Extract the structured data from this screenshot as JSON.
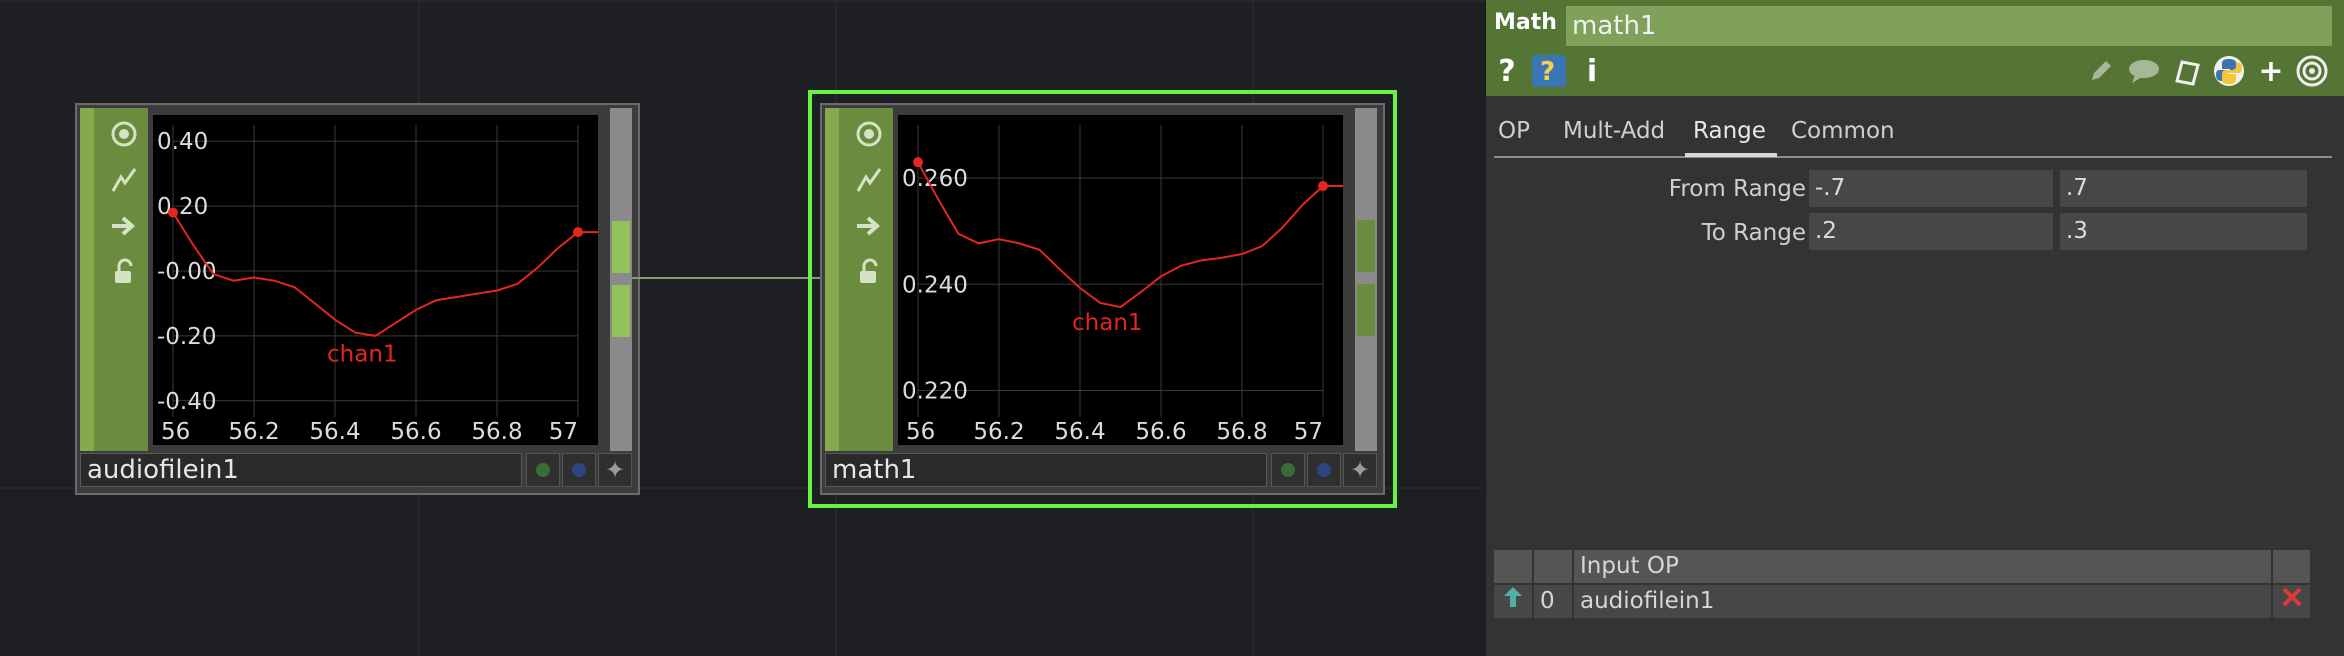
{
  "network": {
    "nodes": [
      {
        "name": "audiofilein1",
        "selected": false,
        "chart_data": {
          "type": "line",
          "series": [
            {
              "name": "chan1",
              "color": "#e3261f",
              "x": [
                56.0,
                56.05,
                56.1,
                56.15,
                56.2,
                56.25,
                56.3,
                56.35,
                56.4,
                56.45,
                56.5,
                56.55,
                56.6,
                56.65,
                56.7,
                56.75,
                56.8,
                56.85,
                56.9,
                56.95,
                57.0
              ],
              "y": [
                0.18,
                0.08,
                -0.01,
                -0.03,
                -0.02,
                -0.03,
                -0.05,
                -0.1,
                -0.15,
                -0.19,
                -0.2,
                -0.16,
                -0.12,
                -0.09,
                -0.08,
                -0.07,
                -0.06,
                -0.04,
                0.01,
                0.07,
                0.12
              ]
            }
          ],
          "xlim": [
            56,
            57
          ],
          "ylim": [
            -0.45,
            0.45
          ],
          "xticks": [
            "56",
            "56.2",
            "56.4",
            "56.6",
            "56.8",
            "57"
          ],
          "yticks": [
            "0.40",
            "0.20",
            "-0.00",
            "-0.20",
            "-0.40"
          ],
          "yvals": [
            0.4,
            0.2,
            0.0,
            -0.2,
            -0.4
          ]
        }
      },
      {
        "name": "math1",
        "selected": true,
        "chart_data": {
          "type": "line",
          "series": [
            {
              "name": "chan1",
              "color": "#e3261f",
              "x": [
                56.0,
                56.05,
                56.1,
                56.15,
                56.2,
                56.25,
                56.3,
                56.35,
                56.4,
                56.45,
                56.5,
                56.55,
                56.6,
                56.65,
                56.7,
                56.75,
                56.8,
                56.85,
                56.9,
                56.95,
                57.0
              ],
              "y": [
                0.263,
                0.256,
                0.2495,
                0.2477,
                0.2485,
                0.2477,
                0.2465,
                0.2428,
                0.2393,
                0.2365,
                0.2357,
                0.2385,
                0.2415,
                0.2435,
                0.2445,
                0.245,
                0.2457,
                0.2472,
                0.2507,
                0.255,
                0.2585
              ]
            }
          ],
          "xlim": [
            56,
            57
          ],
          "ylim": [
            0.215,
            0.27
          ],
          "xticks": [
            "56",
            "56.2",
            "56.4",
            "56.6",
            "56.8",
            "57"
          ],
          "yticks": [
            "0.260",
            "0.240",
            "0.220"
          ],
          "yvals": [
            0.26,
            0.24,
            0.22
          ]
        }
      }
    ]
  },
  "panel": {
    "op_type": "Math",
    "op_name": "math1",
    "tabs": [
      "OP",
      "Mult-Add",
      "Range",
      "Common"
    ],
    "active_tab": "Range",
    "params": [
      {
        "label": "From Range",
        "values": [
          "-.7",
          ".7"
        ]
      },
      {
        "label": "To Range",
        "values": [
          ".2",
          ".3"
        ]
      }
    ],
    "inputs_table": {
      "header": "Input OP",
      "rows": [
        {
          "index": "0",
          "op": "audiofilein1"
        }
      ]
    },
    "header_icons": [
      "help-icon",
      "python-help-icon",
      "info-icon",
      "edit-icon",
      "comment-icon",
      "clone-icon",
      "python-icon",
      "add-icon",
      "viewer-icon"
    ],
    "colors": {
      "node_accent": "#6b8c3e",
      "selected": "#6cf046",
      "header": "#557534",
      "curve": "#e3261f"
    }
  }
}
